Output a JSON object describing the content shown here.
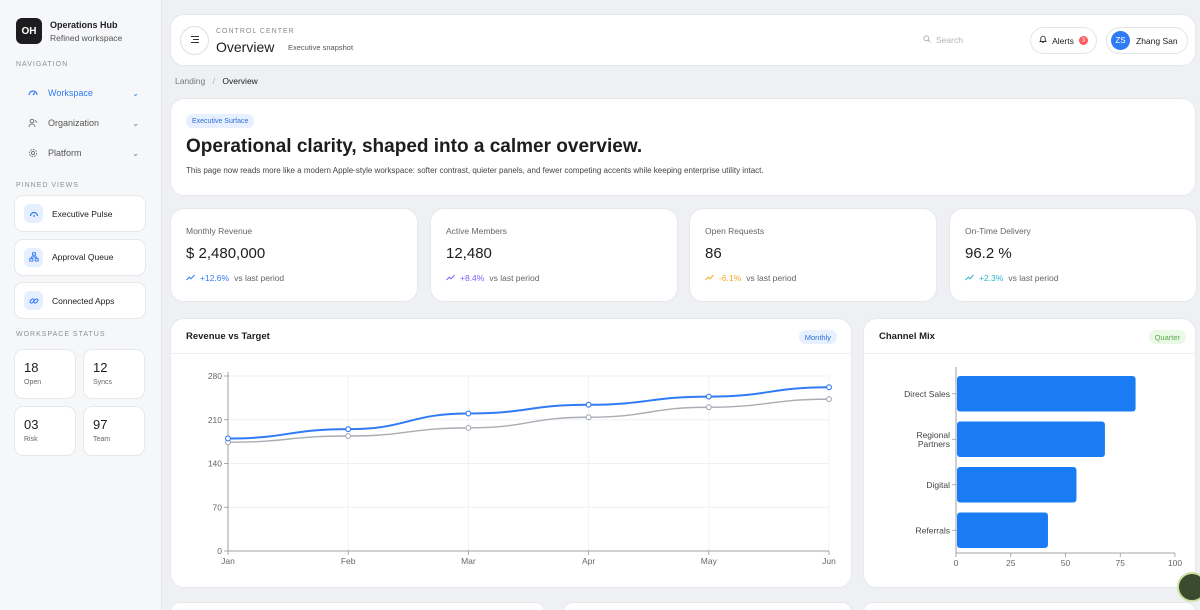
{
  "brand": {
    "logo": "OH",
    "name": "Operations Hub",
    "subtitle": "Refined workspace"
  },
  "sidebar": {
    "nav_title": "NAVIGATION",
    "nav": [
      {
        "label": "Workspace",
        "icon": "dashboard-icon",
        "active": true
      },
      {
        "label": "Organization",
        "icon": "people-icon",
        "active": false
      },
      {
        "label": "Platform",
        "icon": "gear-icon",
        "active": false
      }
    ],
    "pinned_title": "PINNED VIEWS",
    "pinned": [
      {
        "label": "Executive Pulse",
        "icon": "gauge-icon"
      },
      {
        "label": "Approval Queue",
        "icon": "hierarchy-icon"
      },
      {
        "label": "Connected Apps",
        "icon": "link-icon"
      }
    ],
    "status_title": "WORKSPACE STATUS",
    "status": [
      {
        "value": "18",
        "label": "Open"
      },
      {
        "value": "12",
        "label": "Syncs"
      },
      {
        "value": "03",
        "label": "Risk"
      },
      {
        "value": "97",
        "label": "Team"
      }
    ]
  },
  "header": {
    "eyebrow": "CONTROL CENTER",
    "title": "Overview",
    "subtitle": "Executive snapshot",
    "search_placeholder": "Search",
    "alerts_label": "Alerts",
    "alerts_count": "3",
    "user_initials": "ZS",
    "user_name": "Zhang San"
  },
  "breadcrumb": {
    "root": "Landing",
    "sep": "/",
    "current": "Overview"
  },
  "hero": {
    "tag": "Executive Surface",
    "headline": "Operational clarity, shaped into a calmer overview.",
    "body": "This page now reads more like a modern Apple-style workspace: softer contrast, quieter panels, and fewer competing accents while keeping enterprise utility intact."
  },
  "kpis": [
    {
      "label": "Monthly Revenue",
      "value": "$ 2,480,000",
      "delta": "+12.6%",
      "vs": "vs last period",
      "color": "#2f7bf5"
    },
    {
      "label": "Active Members",
      "value": "12,480",
      "delta": "+8.4%",
      "vs": "vs last period",
      "color": "#7b61ff"
    },
    {
      "label": "Open Requests",
      "value": "86",
      "delta": "-6.1%",
      "vs": "vs last period",
      "color": "#f5a623"
    },
    {
      "label": "On-Time Delivery",
      "value": "96.2 %",
      "delta": "+2.3%",
      "vs": "vs last period",
      "color": "#2bb5c8"
    }
  ],
  "revenue_panel": {
    "title": "Revenue vs Target",
    "tag": "Monthly"
  },
  "channel_panel": {
    "title": "Channel Mix",
    "tag": "Quarter"
  },
  "chart_data": [
    {
      "type": "line",
      "title": "Revenue vs Target",
      "x": [
        "Jan",
        "Feb",
        "Mar",
        "Apr",
        "May",
        "Jun"
      ],
      "ylim": [
        0,
        280
      ],
      "yticks": [
        0,
        70,
        140,
        210,
        280
      ],
      "series": [
        {
          "values": [
            180,
            195,
            220,
            234,
            247,
            262
          ],
          "color": "#2f7bf5"
        },
        {
          "values": [
            174,
            184,
            197,
            214,
            230,
            243
          ],
          "color": "#a9adb4"
        }
      ]
    },
    {
      "type": "bar",
      "orientation": "horizontal",
      "title": "Channel Mix",
      "categories": [
        "Direct Sales",
        "Regional Partners",
        "Digital",
        "Referrals"
      ],
      "values": [
        82,
        68,
        55,
        42
      ],
      "xlim": [
        0,
        100
      ],
      "xticks": [
        0,
        25,
        50,
        75,
        100
      ],
      "color": "#1a7cf5"
    }
  ]
}
